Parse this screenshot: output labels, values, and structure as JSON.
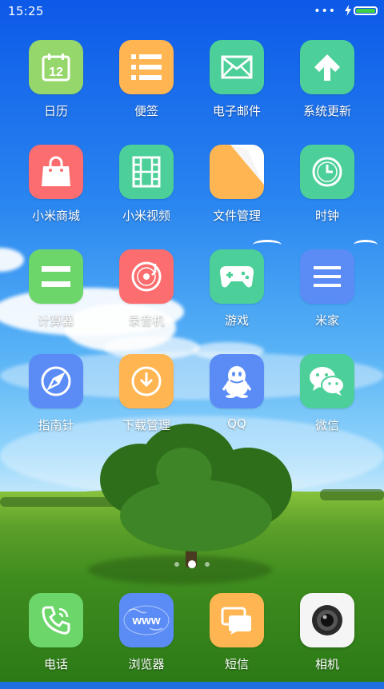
{
  "status_bar": {
    "time": "15:25",
    "more_dots": "•••",
    "battery_fill_pct": 100,
    "battery_color": "#3fd046",
    "charging": true
  },
  "apps": [
    {
      "id": "calendar",
      "label": "日历",
      "icon": "calendar-icon",
      "color": "#95d76a",
      "date": "12"
    },
    {
      "id": "notes",
      "label": "便签",
      "icon": "list-icon",
      "color": "#ffb652"
    },
    {
      "id": "email",
      "label": "电子邮件",
      "icon": "mail-icon",
      "color": "#4ccf98"
    },
    {
      "id": "updater",
      "label": "系统更新",
      "icon": "arrow-up-icon",
      "color": "#4ccf98"
    },
    {
      "id": "mall",
      "label": "小米商城",
      "icon": "shopping-bag-icon",
      "color": "#fb6d6e"
    },
    {
      "id": "video",
      "label": "小米视频",
      "icon": "film-icon",
      "color": "#4ccf98"
    },
    {
      "id": "files",
      "label": "文件管理",
      "icon": "folder-icon",
      "color": "#ffb652"
    },
    {
      "id": "clock",
      "label": "时钟",
      "icon": "clock-icon",
      "color": "#4ccf98"
    },
    {
      "id": "calculator",
      "label": "计算器",
      "icon": "equals-icon",
      "color": "#6cd66a"
    },
    {
      "id": "recorder",
      "label": "录音机",
      "icon": "record-disc-icon",
      "color": "#fb6d6e"
    },
    {
      "id": "games",
      "label": "游戏",
      "icon": "gamepad-icon",
      "color": "#4ccf98"
    },
    {
      "id": "mihome",
      "label": "米家",
      "icon": "menu-icon",
      "color": "#5b8cf6"
    },
    {
      "id": "compass",
      "label": "指南针",
      "icon": "compass-icon",
      "color": "#5b8cf6"
    },
    {
      "id": "downloads",
      "label": "下载管理",
      "icon": "download-icon",
      "color": "#ffb652"
    },
    {
      "id": "qq",
      "label": "QQ",
      "icon": "qq-penguin-icon",
      "color": "#5b8cf6"
    },
    {
      "id": "wechat",
      "label": "微信",
      "icon": "wechat-icon",
      "color": "#4ccf98"
    }
  ],
  "dock": [
    {
      "id": "phone",
      "label": "电话",
      "icon": "phone-icon",
      "color": "#6cd66a"
    },
    {
      "id": "browser",
      "label": "浏览器",
      "icon": "globe-www-icon",
      "color": "#5b8cf6",
      "text": "www"
    },
    {
      "id": "messages",
      "label": "短信",
      "icon": "chat-bubbles-icon",
      "color": "#ffb652"
    },
    {
      "id": "camera",
      "label": "相机",
      "icon": "camera-lens-icon",
      "color": "#f5f5f5"
    }
  ],
  "pager": {
    "pages": 3,
    "active": 2
  }
}
